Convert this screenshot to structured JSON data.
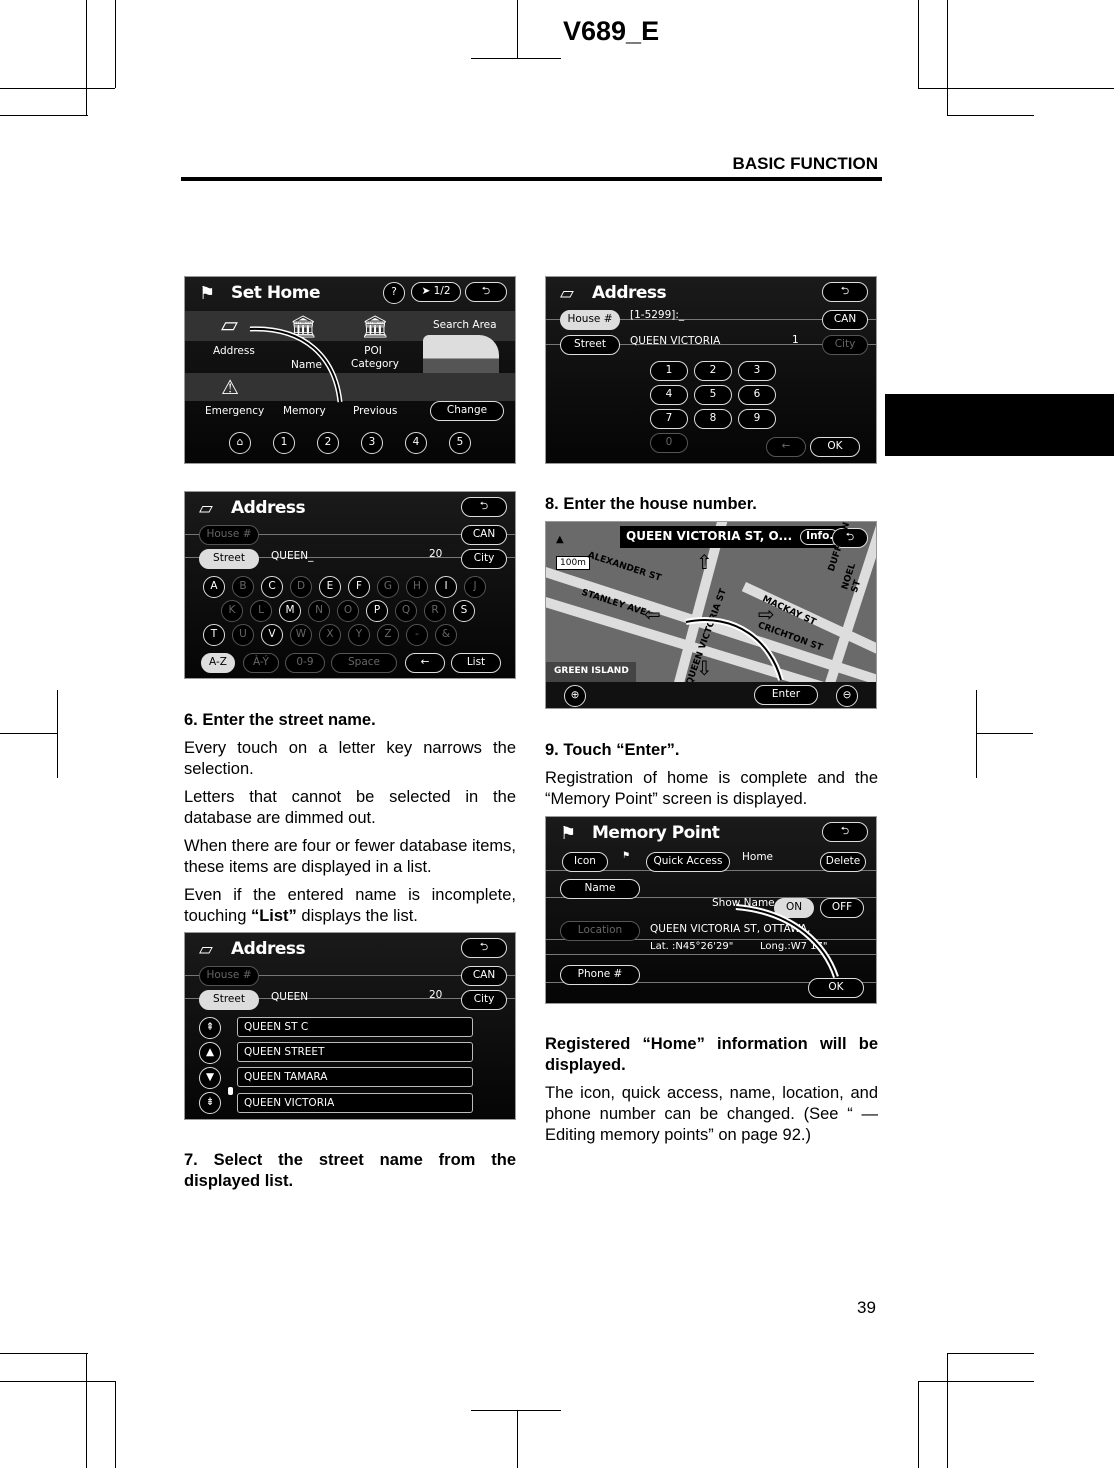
{
  "header": {
    "doc_code": "V689_E",
    "section": "BASIC FUNCTION",
    "page_number": "39"
  },
  "screens": {
    "set_home": {
      "title": "Set Home",
      "help": "?",
      "page": "1/2",
      "back": "back",
      "items": [
        "Address",
        "Name",
        "POI Category",
        "Emergency",
        "Memory",
        "Previous"
      ],
      "search_area": "Search Area",
      "change": "Change",
      "presets": [
        "1",
        "2",
        "3",
        "4",
        "5"
      ]
    },
    "address_kb": {
      "title": "Address",
      "house": "House #",
      "street": "Street",
      "input": "QUEEN_",
      "count": "20",
      "can": "CAN",
      "city": "City",
      "keys": [
        [
          "A",
          1
        ],
        [
          "B",
          0
        ],
        [
          "C",
          1
        ],
        [
          "D",
          0
        ],
        [
          "E",
          1
        ],
        [
          "F",
          1
        ],
        [
          "G",
          0
        ],
        [
          "H",
          0
        ],
        [
          "I",
          1
        ],
        [
          "J",
          0
        ],
        [
          "K",
          0
        ],
        [
          "L",
          0
        ],
        [
          "M",
          1
        ],
        [
          "N",
          0
        ],
        [
          "O",
          0
        ],
        [
          "P",
          1
        ],
        [
          "Q",
          0
        ],
        [
          "R",
          0
        ],
        [
          "S",
          1
        ],
        [
          "T",
          1
        ],
        [
          "U",
          0
        ],
        [
          "V",
          1
        ],
        [
          "W",
          0
        ],
        [
          "X",
          0
        ],
        [
          "Y",
          0
        ],
        [
          "Z",
          0
        ],
        [
          "-",
          0
        ],
        [
          "&",
          0
        ]
      ],
      "bottom": [
        "A-Z",
        "À-Ý",
        "0-9",
        "Space",
        "←",
        "List"
      ]
    },
    "address_list": {
      "title": "Address",
      "house": "House #",
      "street": "Street",
      "input": "QUEEN",
      "count": "20",
      "can": "CAN",
      "city": "City",
      "items": [
        "QUEEN ST C",
        "QUEEN STREET",
        "QUEEN TAMARA",
        "QUEEN VICTORIA"
      ]
    },
    "house_num": {
      "title": "Address",
      "house": "House #",
      "range": "[1-5299]:_",
      "street": "Street",
      "street_value": "QUEEN VICTORIA",
      "count": "1",
      "can": "CAN",
      "city": "City",
      "keys": [
        "1",
        "2",
        "3",
        "4",
        "5",
        "6",
        "7",
        "8",
        "9",
        "0"
      ],
      "back": "←",
      "ok": "OK"
    },
    "map": {
      "location": "QUEEN VICTORIA ST, O...",
      "info": "Info.",
      "scale": "100m",
      "streets": [
        "ALEXANDER ST",
        "STANLEY AVE",
        "QUEEN VICTORIA ST",
        "MACKAY ST",
        "CRICHTON ST",
        "DUFFERIN",
        "NOEL ST",
        "GREEN ISLAND"
      ],
      "enter": "Enter"
    },
    "memory": {
      "title": "Memory Point",
      "icon": "Icon",
      "quick": "Quick Access",
      "home": "Home",
      "delete": "Delete",
      "name": "Name",
      "show_name": "Show Name",
      "on": "ON",
      "off": "OFF",
      "location": "Location",
      "address": "QUEEN VICTORIA ST, OTTAWA,",
      "lat": "Lat.  :N45°26'29\"",
      "long": "Long.:W7  17\"",
      "phone": "Phone #",
      "ok": "OK"
    }
  },
  "left": {
    "step6": "6.    Enter the street name.",
    "p1": "Every touch on a letter key narrows the selection.",
    "p2": "Letters that cannot be selected in the database are dimmed out.",
    "p3": "When there are four or fewer database items, these items are displayed in a list.",
    "p4a": "Even if the entered name is incomplete, touching ",
    "p4b": "“List”",
    "p4c": " displays the list.",
    "step7": "7.    Select the street name from the displayed list."
  },
  "right": {
    "step8": "8.    Enter the house number.",
    "step9": "9.    Touch “Enter”.",
    "p1": "Registration of home is complete and the “Memory Point” screen is displayed.",
    "reg": "Registered “Home” information will be displayed.",
    "p2": "The icon, quick access, name, location, and phone number can be changed. (See “ — Editing memory points” on page 92.)"
  }
}
